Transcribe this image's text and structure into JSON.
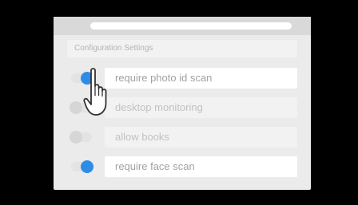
{
  "panel": {
    "title": "Configuration Settings"
  },
  "settings": [
    {
      "label": "require photo id scan",
      "enabled": true
    },
    {
      "label": "desktop monitoring",
      "enabled": false
    },
    {
      "label": "allow books",
      "enabled": false
    },
    {
      "label": "require face scan",
      "enabled": true
    }
  ],
  "colors": {
    "toggle_on": "#2d8de6",
    "toggle_off": "#d6d6d6",
    "background": "#000000"
  },
  "cursor": {
    "type": "pointer-hand-icon"
  }
}
